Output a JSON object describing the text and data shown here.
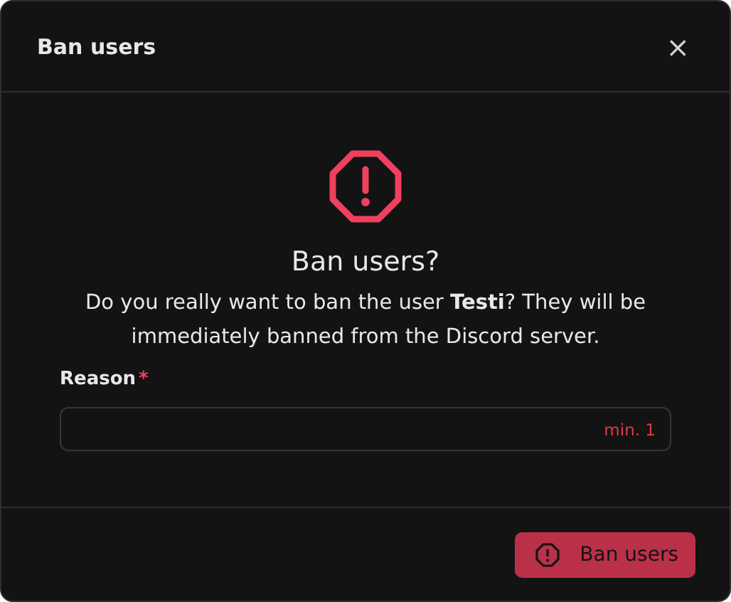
{
  "dialog": {
    "title": "Ban users",
    "close": "×"
  },
  "body": {
    "heading": "Ban users?",
    "message": "Do you really want to ban the user **Testi**? They will be immediately banned from the Discord server."
  },
  "reason": {
    "label": "Reason",
    "required_mark": "*",
    "hint": "min. 1"
  },
  "buttons": [
    {
      "label": "Ban users",
      "disabled": true
    }
  ]
}
